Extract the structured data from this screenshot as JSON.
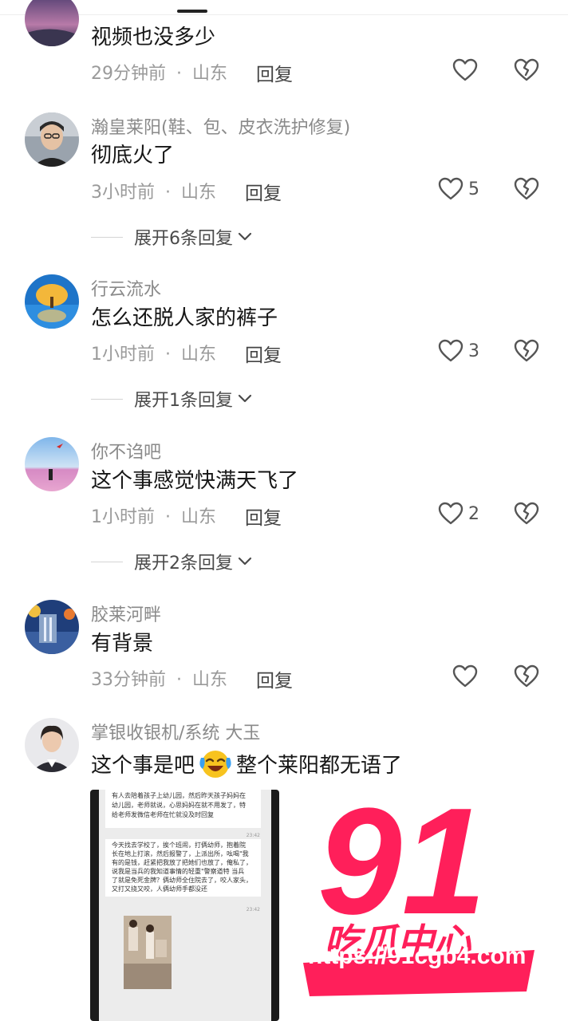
{
  "comments": [
    {
      "username": "",
      "text": "视频也没多少",
      "time": "29分钟前",
      "location": "山东",
      "reply_label": "回复",
      "likes": "",
      "expand_label": ""
    },
    {
      "username": "瀚皇莱阳(鞋、包、皮衣洗护修复)",
      "text": "彻底火了",
      "time": "3小时前",
      "location": "山东",
      "reply_label": "回复",
      "likes": "5",
      "expand_label": "展开6条回复"
    },
    {
      "username": "行云流水",
      "text": "怎么还脱人家的裤子",
      "time": "1小时前",
      "location": "山东",
      "reply_label": "回复",
      "likes": "3",
      "expand_label": "展开1条回复"
    },
    {
      "username": "你不诌吧",
      "text": "这个事感觉快满天飞了",
      "time": "1小时前",
      "location": "山东",
      "reply_label": "回复",
      "likes": "2",
      "expand_label": "展开2条回复"
    },
    {
      "username": "胶莱河畔",
      "text": "有背景",
      "time": "33分钟前",
      "location": "山东",
      "reply_label": "回复",
      "likes": "",
      "expand_label": ""
    },
    {
      "username": "掌银收银机/系统 大玉",
      "text_before_emoji": "这个事是吧",
      "emoji": "laughing-crying-emoji",
      "text_after_emoji": "整个莱阳都无语了"
    }
  ],
  "dot": "·",
  "screenshot_lines": [
    "有人去陪着孩子上幼儿园，然后昨天孩子妈妈在",
    "幼儿园，老师就说，心思妈妈在就不用发了，特",
    "给老师发微信老师在忙就没及时回复",
    "今天找去学校了，挨个班闹，打俩幼师，抱着院",
    "长在地上打滚，然后报警了，上派出所，吆喝\"我",
    "有的是钱，赶紧把我放了把她们也放了，俺私了，",
    "说我是当兵的我知道事情的轻重\"警察道特 当兵",
    "了就是免死金牌？俩幼师全住院去了，咬人家头，",
    "又打又挠又咬，人俩幼师手都没还"
  ],
  "screenshot_times": [
    "23:42",
    "23:42"
  ],
  "watermark": {
    "number": "91",
    "brand": "吃瓜中心",
    "url": "https://91cgb4.com"
  },
  "colors": {
    "accent": "#ff1f5a",
    "text": "#161616",
    "muted": "#8a8a8a"
  }
}
